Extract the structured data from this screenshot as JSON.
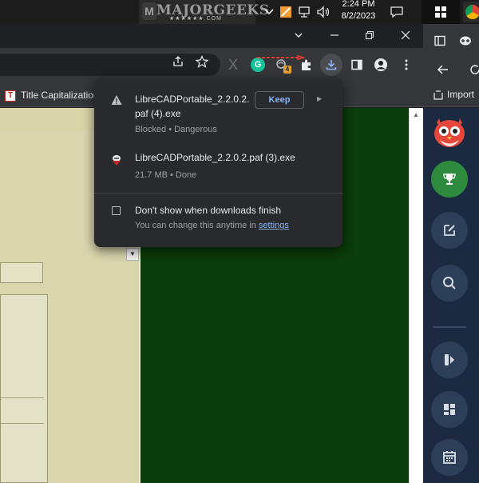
{
  "taskbar": {
    "brand_word": "MAJORGEEKS",
    "brand_sub": "★★★★★★.COM",
    "brand_mark": "M",
    "clock_time": "2:24 PM",
    "clock_date": "8/2/2023",
    "icons": [
      "chevron-up-icon",
      "app-icon",
      "network-icon",
      "volume-icon",
      "notification-icon",
      "windows-start-icon",
      "chrome-icon"
    ]
  },
  "browser": {
    "window_controls": [
      "chevron-down-icon",
      "minimize-icon",
      "restore-icon",
      "close-icon"
    ],
    "toolbar_icons": [
      "share-icon",
      "star-icon",
      "x-extension-icon",
      "grammarly-icon",
      "extension-badge-icon",
      "puzzle-icon",
      "download-icon",
      "sidepanel-icon",
      "profile-icon",
      "menu-icon"
    ],
    "grammarly_letter": "G",
    "extension_badge": "4",
    "bookmark": {
      "favicon": "T",
      "label": "Title Capitalization"
    }
  },
  "downloads_popup": {
    "items": [
      {
        "name_line1": "LibreCADPortable_2.2.0.2.",
        "name_line2": "paf (4).exe",
        "status": "Blocked • Dangerous",
        "icon": "warning-icon",
        "action_label": "Keep"
      },
      {
        "name_line1": "LibreCADPortable_2.2.0.2.paf (3).exe",
        "status": "21.7 MB • Done",
        "icon": "librecad-file-icon"
      }
    ],
    "checkbox_label": "Don't show when downloads finish",
    "hint_prefix": "You can change this anytime in ",
    "hint_link": "settings"
  },
  "side_panel": {
    "bookmark_label": "Import",
    "buttons": [
      "trophy-icon",
      "edit-icon",
      "search-icon",
      "flash-icon",
      "dashboard-icon",
      "calendar-icon"
    ]
  },
  "colors": {
    "page_background": "#0b3c0b",
    "form_panel": "#d7d4a8",
    "accent_link": "#8ab4f8",
    "red_arrow": "#e53935"
  }
}
